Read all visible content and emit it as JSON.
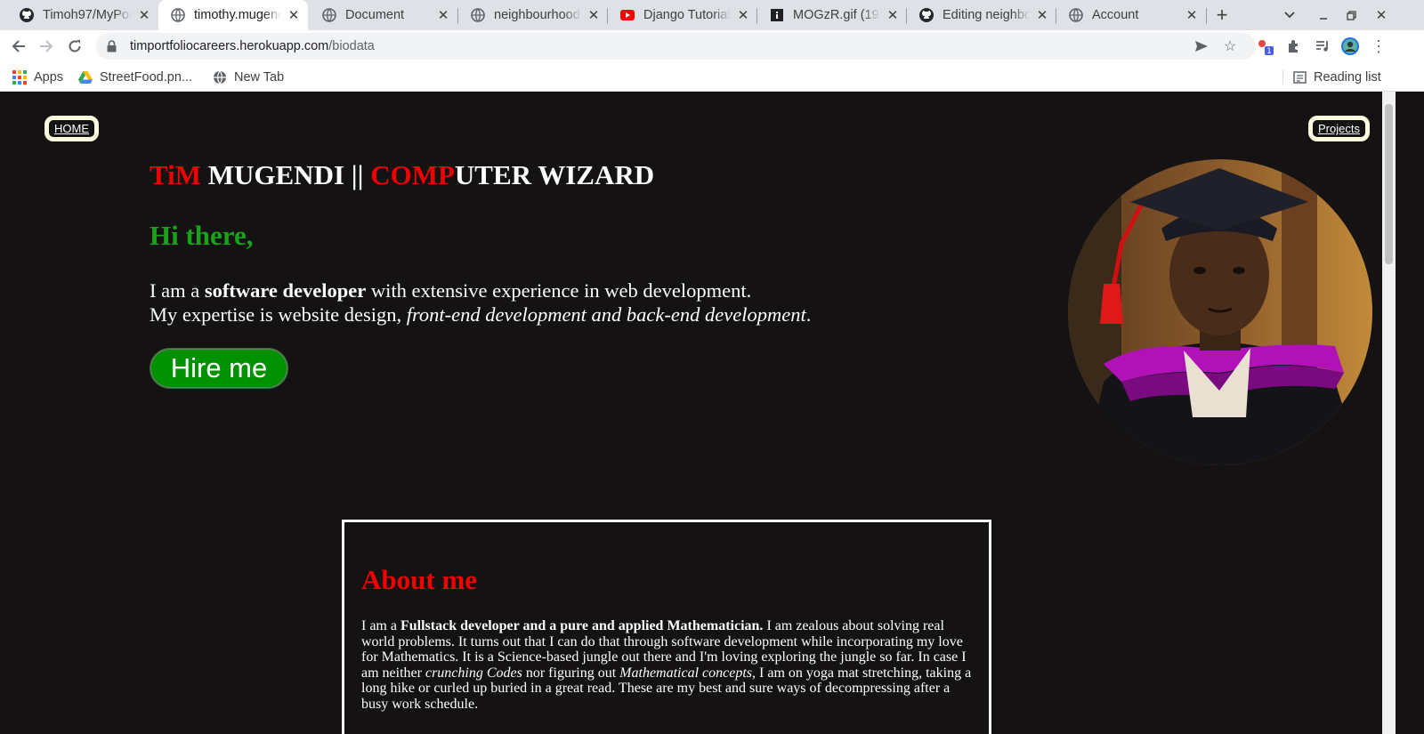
{
  "tabs": [
    {
      "title": "Timoh97/MyPortfolio",
      "icon": "github-icon"
    },
    {
      "title": "timothy.mugendi",
      "icon": "globe-icon"
    },
    {
      "title": "Document",
      "icon": "globe-icon"
    },
    {
      "title": "neighbourhood",
      "icon": "globe-icon"
    },
    {
      "title": "Django Tutorial",
      "icon": "youtube-icon"
    },
    {
      "title": "MOGzR.gif (1920",
      "icon": "image-icon"
    },
    {
      "title": "Editing neighbourhood",
      "icon": "github-icon"
    },
    {
      "title": "Account",
      "icon": "globe-icon"
    }
  ],
  "address": {
    "host": "timportfoliocareers.herokuapp.com",
    "path": "/biodata"
  },
  "bookmarks": {
    "apps": "Apps",
    "streetfood": "StreetFood.pn...",
    "newtab": "New Tab",
    "reading_list": "Reading list"
  },
  "extension_badge": "1",
  "nav": {
    "home": "HOME",
    "projects": "Projects"
  },
  "hero": {
    "title_part1": "TiM",
    "title_part2": " MUGENDI || ",
    "title_part3": "COMP",
    "title_part4": "UTER WIZARD",
    "greeting": "Hi there,",
    "intro_line1_a": "I am a ",
    "intro_line1_b": "software developer",
    "intro_line1_c": " with extensive experience in web development.",
    "intro_line2_a": "My expertise is website design, ",
    "intro_line2_b": "front-end development and back-end development",
    "intro_line2_c": ".",
    "hire_button": "Hire me"
  },
  "about": {
    "heading": "About me",
    "p_a": "I am a ",
    "p_b": "Fullstack developer and a pure and applied Mathematician.",
    "p_c": " I am zealous about solving real world problems. It turns out that I can do that through software development while incorporating my love for Mathematics. It is a Science-based jungle out there and I'm loving exploring the jungle so far. In case I am neither ",
    "p_d": "crunching Codes",
    "p_e": " nor figuring out ",
    "p_f": "Mathematical concepts",
    "p_g": ", I am on yoga mat stretching, taking a long hike or curled up buried in a great read. These are my best and sure ways of decompressing after a busy work schedule."
  },
  "colors": {
    "accent_red": "#f00000",
    "accent_green": "#1aa31a",
    "button_green": "#009100",
    "page_bg": "#141213"
  }
}
